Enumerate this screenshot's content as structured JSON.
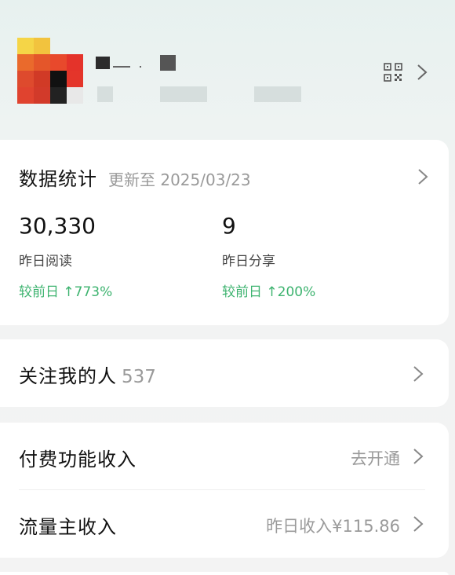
{
  "profile": {
    "qr_icon": "qr-code-icon",
    "chevron_icon": "chevron-right-icon"
  },
  "stats": {
    "title": "数据统计",
    "updated": "更新至 2025/03/23",
    "metrics": [
      {
        "value": "30,330",
        "label": "昨日阅读",
        "change": "较前日 ↑773%"
      },
      {
        "value": "9",
        "label": "昨日分享",
        "change": "较前日 ↑200%"
      }
    ]
  },
  "followers": {
    "label": "关注我的人",
    "count": "537"
  },
  "income": {
    "paid_label": "付费功能收入",
    "paid_action": "去开通",
    "traffic_label": "流量主收入",
    "traffic_value": "昨日收入¥115.86"
  },
  "colors": {
    "accent_green": "#3db36f",
    "secondary_text": "#9a9a9a"
  }
}
